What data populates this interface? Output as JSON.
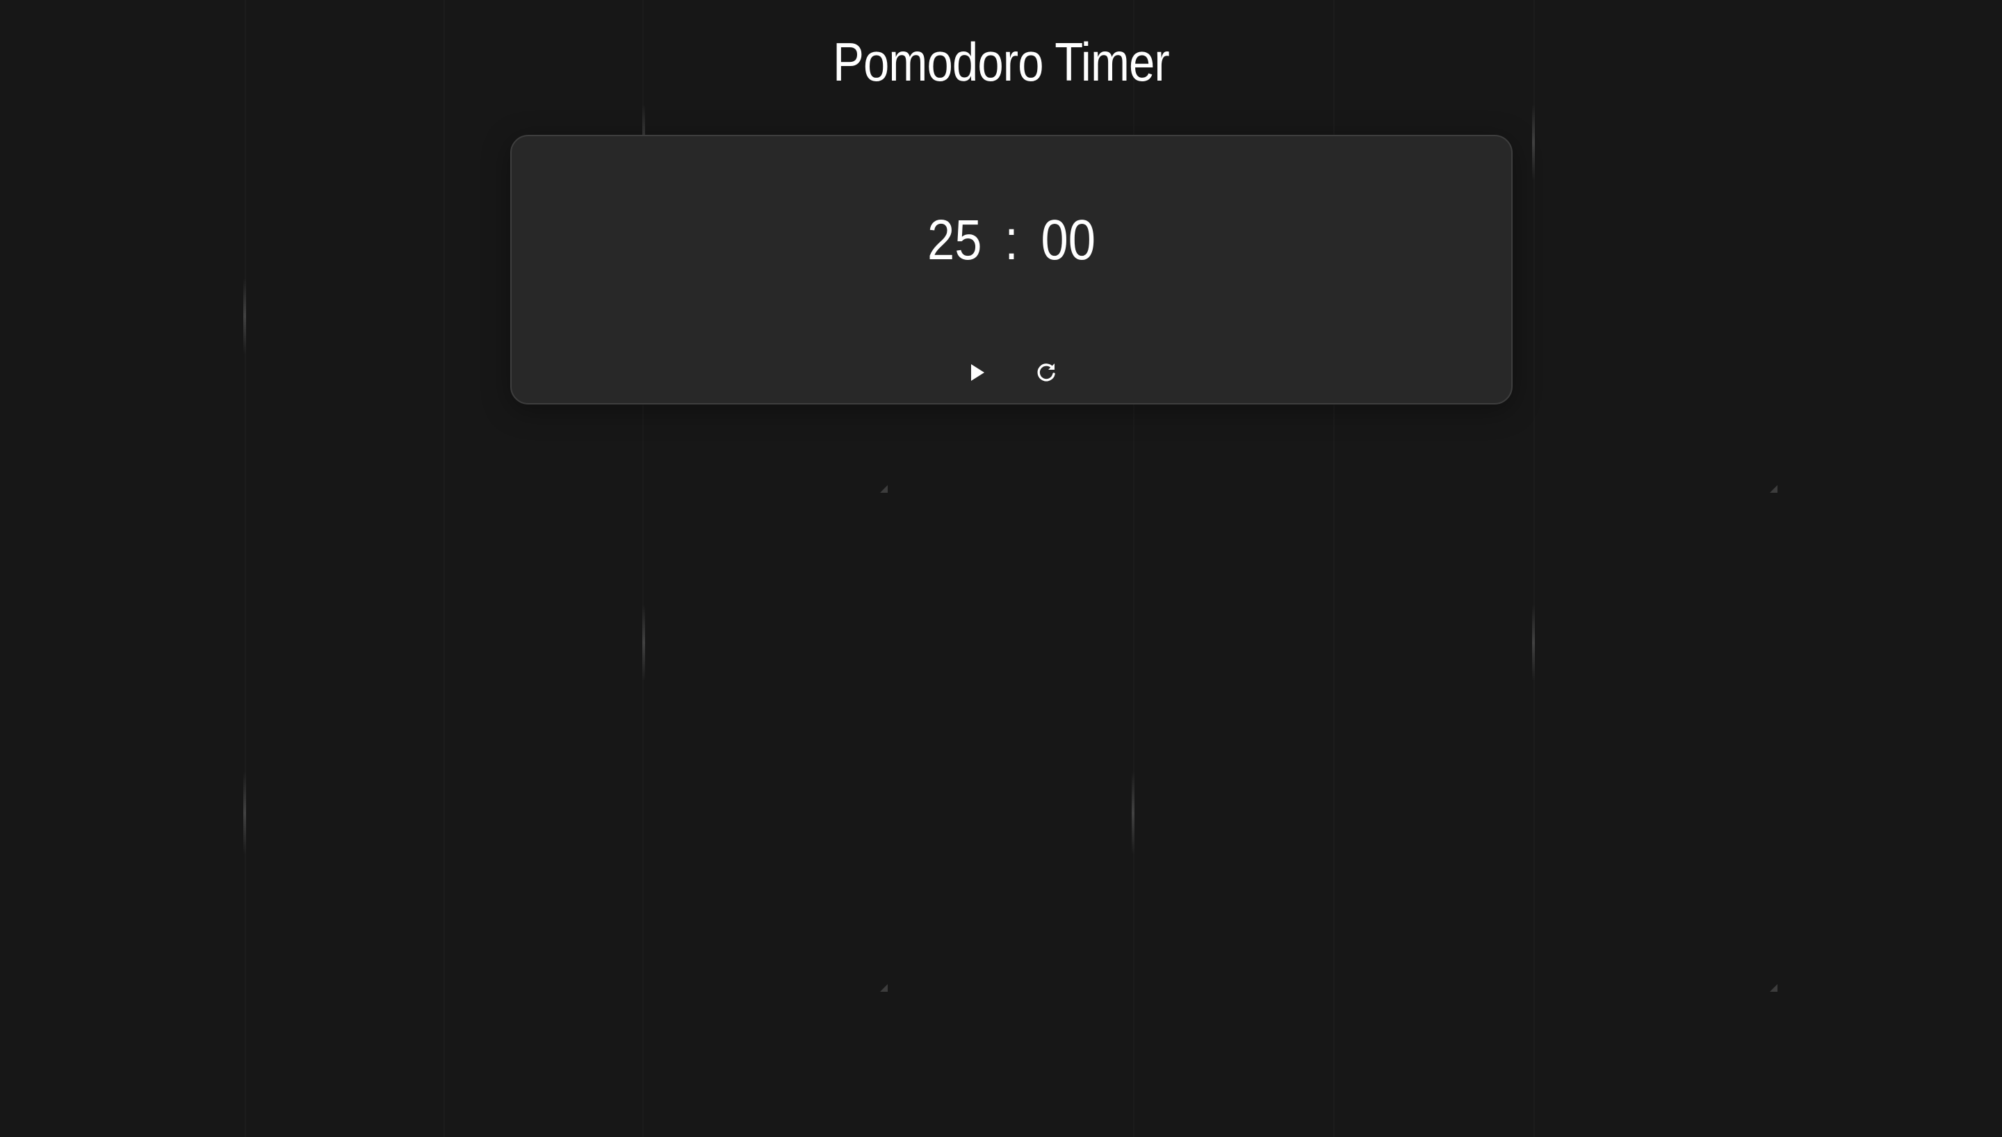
{
  "app": {
    "title": "Pomodoro Timer"
  },
  "timer": {
    "minutes": "25",
    "separator": ":",
    "seconds": "00"
  },
  "controls": {
    "play_icon": "play-icon",
    "reset_icon": "reset-icon"
  },
  "colors": {
    "background": "#171717",
    "card": "#282828",
    "card_border": "#3e3e3e",
    "text": "#ffffff"
  }
}
